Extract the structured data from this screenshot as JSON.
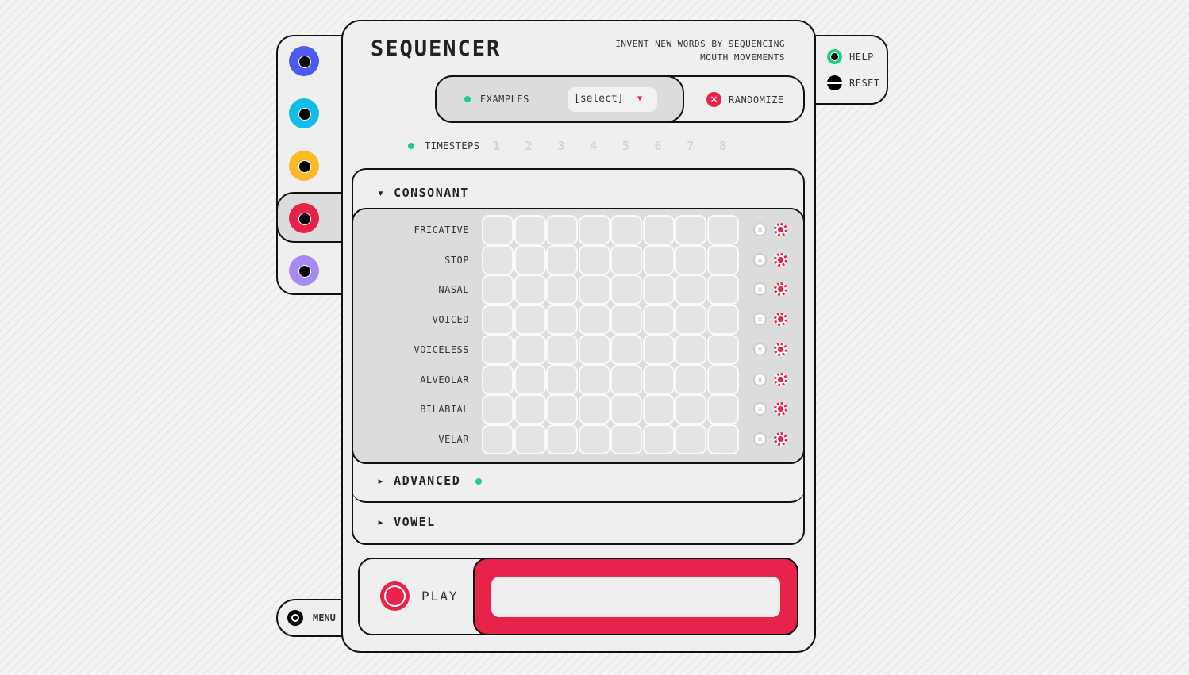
{
  "title": "SEQUENCER",
  "subtitle_line1": "INVENT NEW WORDS BY SEQUENCING",
  "subtitle_line2": "MOUTH MOVEMENTS",
  "examples": {
    "label": "EXAMPLES",
    "select_value": "[select]"
  },
  "randomize_label": "RANDOMIZE",
  "help_label": "HELP",
  "reset_label": "RESET",
  "menu_label": "MENU",
  "play_label": "PLAY",
  "timesteps": {
    "label": "TIMESTEPS",
    "steps": [
      "1",
      "2",
      "3",
      "4",
      "5",
      "6",
      "7",
      "8"
    ]
  },
  "sections": {
    "consonant": "CONSONANT",
    "advanced": "ADVANCED",
    "vowel": "VOWEL"
  },
  "rows": [
    "FRICATIVE",
    "STOP",
    "NASAL",
    "VOICED",
    "VOICELESS",
    "ALVEOLAR",
    "BILABIAL",
    "VELAR"
  ],
  "channels": [
    {
      "color": "#4a5cf0"
    },
    {
      "color": "#10bde8"
    },
    {
      "color": "#fbb829"
    },
    {
      "color": "#e8234a",
      "selected": true
    },
    {
      "color": "#a98af2"
    }
  ],
  "colors": {
    "accent": "#e8234a",
    "green": "#1ecf86"
  }
}
